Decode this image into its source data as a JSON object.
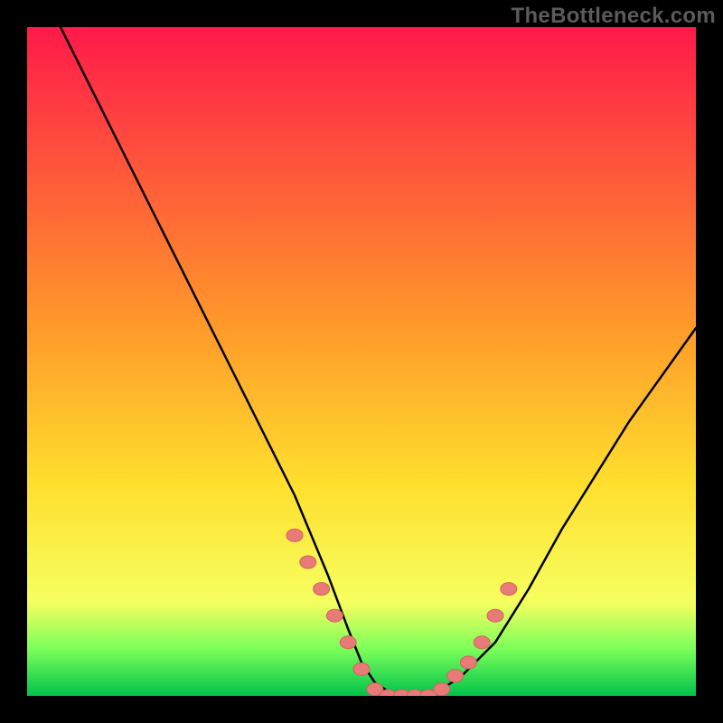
{
  "watermark": "TheBottleneck.com",
  "colors": {
    "background": "#000000",
    "gradient_top": "#ff1a4a",
    "gradient_mid": "#ffde2d",
    "gradient_low": "#f6ff60",
    "gradient_green_light": "#7bff5a",
    "gradient_green_dark": "#00c24a",
    "curve_stroke": "#000000",
    "marker_fill": "#e87b77",
    "marker_stroke": "#d5615d"
  },
  "chart_data": {
    "type": "line",
    "title": "",
    "xlabel": "",
    "ylabel": "",
    "xlim": [
      0,
      100
    ],
    "ylim": [
      0,
      100
    ],
    "series": [
      {
        "name": "bottleneck-curve",
        "x": [
          5,
          10,
          15,
          20,
          25,
          30,
          35,
          40,
          45,
          48,
          50,
          52,
          55,
          58,
          60,
          62,
          65,
          70,
          75,
          80,
          85,
          90,
          95,
          100
        ],
        "y": [
          100,
          90,
          80,
          70,
          60,
          50,
          40,
          30,
          18,
          10,
          5,
          2,
          0,
          0,
          0,
          1,
          3,
          8,
          16,
          25,
          33,
          41,
          48,
          55
        ]
      }
    ],
    "markers": {
      "name": "sample-points",
      "x": [
        40,
        42,
        44,
        46,
        48,
        50,
        52,
        54,
        56,
        58,
        60,
        62,
        64,
        66,
        68,
        70,
        72
      ],
      "y": [
        24,
        20,
        16,
        12,
        8,
        4,
        1,
        0,
        0,
        0,
        0,
        1,
        3,
        5,
        8,
        12,
        16
      ]
    }
  }
}
